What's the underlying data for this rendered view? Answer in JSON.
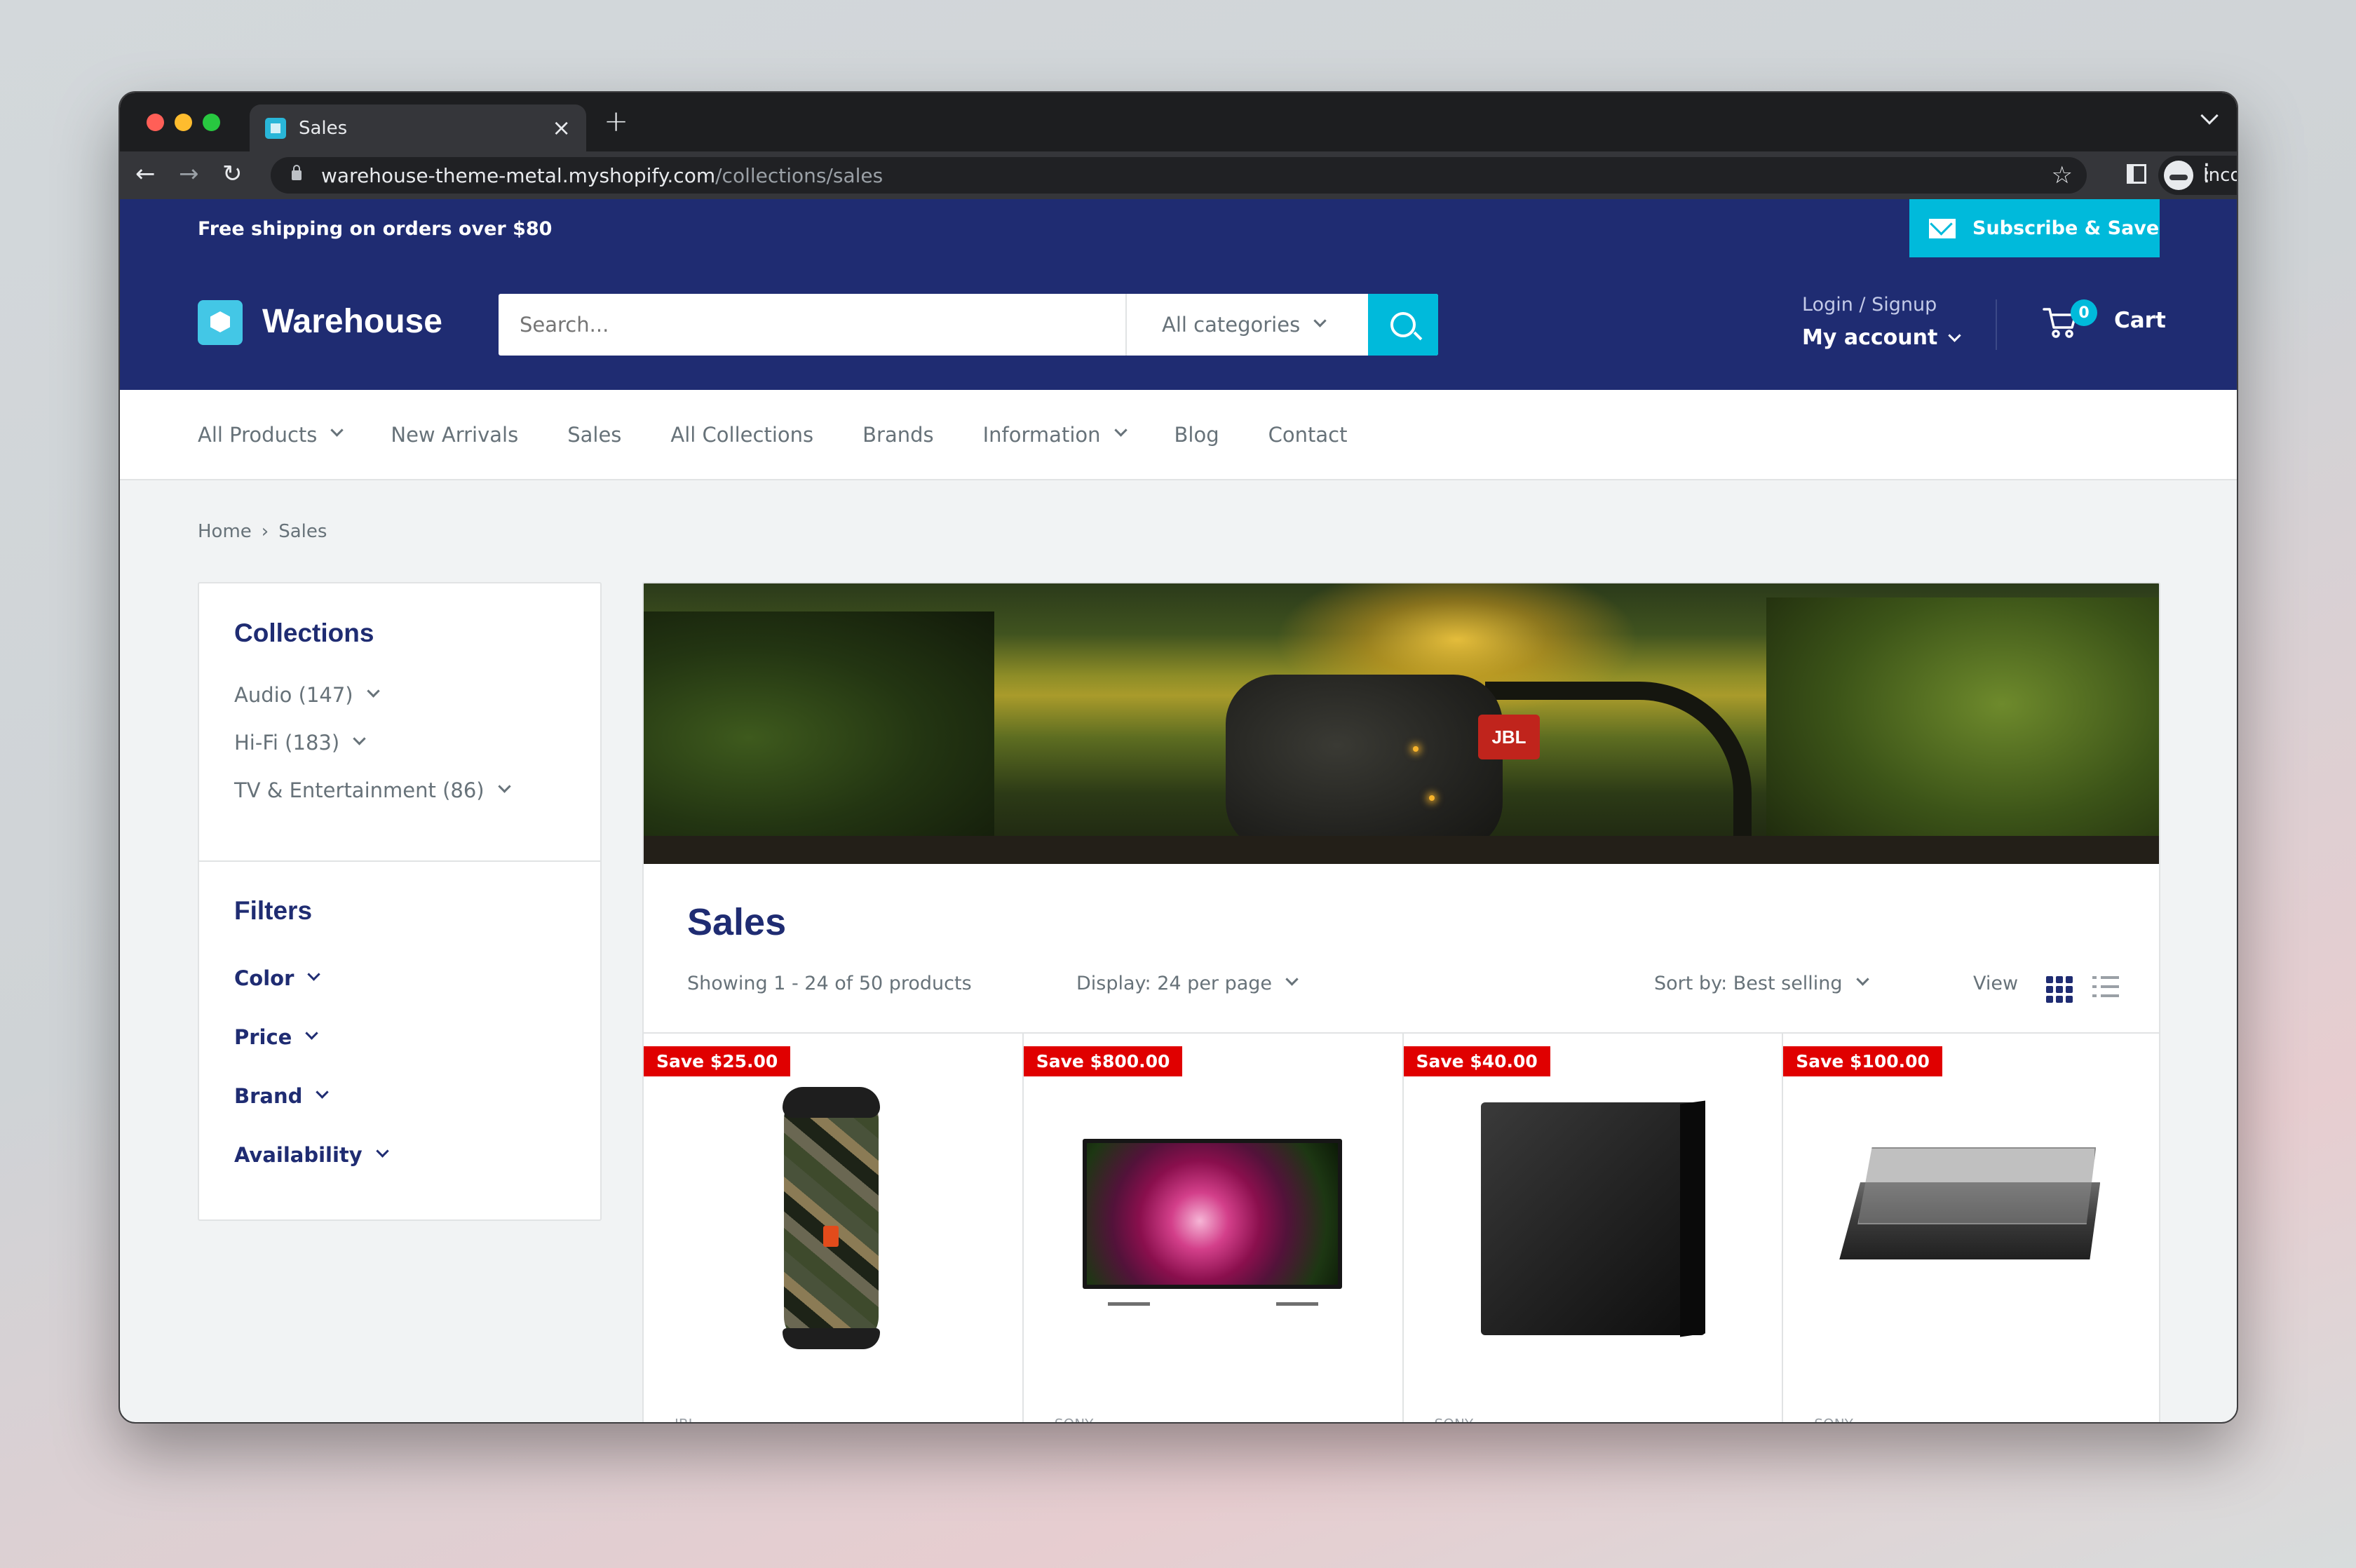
{
  "browser": {
    "tab_title": "Sales",
    "tab_close": "×",
    "new_tab": "+",
    "url_host": "warehouse-theme-metal.myshopify.com",
    "url_path": "/collections/sales",
    "incognito_label": "Incognito",
    "back": "←",
    "forward": "→",
    "reload": "↻",
    "star": "☆",
    "menu": "⋮"
  },
  "announcement": {
    "text": "Free shipping on orders over $80",
    "subscribe_label": "Subscribe & Save"
  },
  "header": {
    "logo_text": "Warehouse",
    "search_placeholder": "Search...",
    "search_category": "All categories",
    "account_top": "Login / Signup",
    "account_bottom": "My account",
    "cart_count": "0",
    "cart_label": "Cart"
  },
  "menu": {
    "items": [
      {
        "label": "All Products",
        "dropdown": true
      },
      {
        "label": "New Arrivals",
        "dropdown": false
      },
      {
        "label": "Sales",
        "dropdown": false
      },
      {
        "label": "All Collections",
        "dropdown": false
      },
      {
        "label": "Brands",
        "dropdown": false
      },
      {
        "label": "Information",
        "dropdown": true
      },
      {
        "label": "Blog",
        "dropdown": false
      },
      {
        "label": "Contact",
        "dropdown": false
      }
    ]
  },
  "breadcrumb": {
    "home": "Home",
    "sep": "›",
    "current": "Sales"
  },
  "sidebar": {
    "collections_title": "Collections",
    "collections": [
      "Audio (147)",
      "Hi-Fi (183)",
      "TV & Entertainment (86)"
    ],
    "filters_title": "Filters",
    "filters": [
      "Color",
      "Price",
      "Brand",
      "Availability"
    ]
  },
  "collection": {
    "title": "Sales",
    "banner_brand": "JBL",
    "showing": "Showing 1 - 24 of 50 products",
    "display": "Display: 24 per page",
    "sort": "Sort by: Best selling",
    "view_label": "View"
  },
  "products": [
    {
      "badge": "Save $25.00",
      "vendor": "JBL"
    },
    {
      "badge": "Save $800.00",
      "vendor": "SONY"
    },
    {
      "badge": "Save $40.00",
      "vendor": "SONY"
    },
    {
      "badge": "Save $100.00",
      "vendor": "SONY"
    }
  ],
  "colors": {
    "primary": "#1f2c72",
    "accent": "#00badb",
    "sale_badge": "#e00000",
    "text_muted": "#677279"
  }
}
